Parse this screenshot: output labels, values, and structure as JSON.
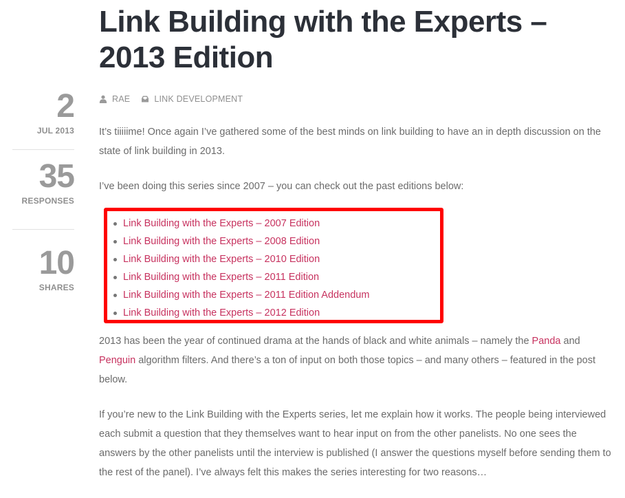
{
  "post": {
    "title": "Link Building with the Experts – 2013 Edition",
    "author": "RAE",
    "category": "LINK DEVELOPMENT",
    "author_icon": "user-icon",
    "category_icon": "inbox-folder-icon"
  },
  "sidebar": {
    "date_day": "2",
    "date_month_year": "JUL 2013",
    "responses_count": "35",
    "responses_label": "RESPONSES",
    "shares_count": "10",
    "shares_label": "SHARES"
  },
  "content": {
    "intro_paragraph": "It’s tiiiiime! Once again I’ve gathered some of the best minds on link building to have an in depth discussion on the state of link building in 2013.",
    "series_paragraph": "I’ve been doing this series since 2007 – you can check out the past editions below:",
    "past_editions": [
      {
        "label": "Link Building with the Experts – 2007 Edition"
      },
      {
        "label": "Link Building with the Experts – 2008 Edition"
      },
      {
        "label": "Link Building with the Experts – 2010 Edition"
      },
      {
        "label": "Link Building with the Experts – 2011 Edition"
      },
      {
        "label": "Link Building with the Experts – 2011 Edition Addendum"
      },
      {
        "label": "Link Building with the Experts – 2012 Edition"
      }
    ],
    "drama_paragraph": {
      "part1": "2013 has been the year of continued drama at the hands of black and white animals – namely the ",
      "link_panda": "Panda",
      "part2": " and ",
      "link_penguin": "Penguin",
      "part3": " algorithm filters. And there’s a ton of input on both those topics – and many others – featured in the post below."
    },
    "explain_paragraph": "If you’re new to the Link Building with the Experts series, let me explain how it works. The people being interviewed each submit a question that they themselves want to hear input on from the other panelists. No one sees the answers by the other panelists until the interview is published (I answer the questions myself before sending them to the rest of the panel). I’ve always felt this makes the series interesting for two reasons…"
  },
  "colors": {
    "link": "#c7325f",
    "highlight_box": "#ff0000",
    "title": "#2c3038",
    "body_text": "#6b6b6b",
    "meta_text": "#8f8f8f"
  }
}
